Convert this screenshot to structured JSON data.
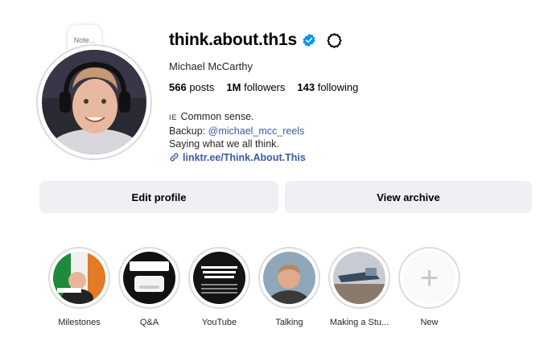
{
  "profile": {
    "note_label": "Note...",
    "username": "think.about.th1s",
    "full_name": "Michael McCarthy",
    "stats": {
      "posts_count": "566",
      "posts_label": "posts",
      "followers_count": "1M",
      "followers_label": "followers",
      "following_count": "143",
      "following_label": "following"
    },
    "bio": {
      "line1_flag": "IE",
      "line1_text": "Common sense.",
      "line2_prefix": "Backup:",
      "line2_mention": "@michael_mcc_reels",
      "line3": "Saying what we all think.",
      "link": "linktr.ee/Think.About.This"
    }
  },
  "buttons": {
    "edit_profile": "Edit profile",
    "view_archive": "View archive"
  },
  "highlights": [
    {
      "label": "Milestones"
    },
    {
      "label": "Q&A"
    },
    {
      "label": "YouTube"
    },
    {
      "label": "Talking"
    },
    {
      "label": "Making a Stu..."
    },
    {
      "label": "New"
    }
  ],
  "colors": {
    "verified_blue": "#0095f6",
    "link": "#3b5aa3",
    "button_bg": "#eff0f3"
  }
}
